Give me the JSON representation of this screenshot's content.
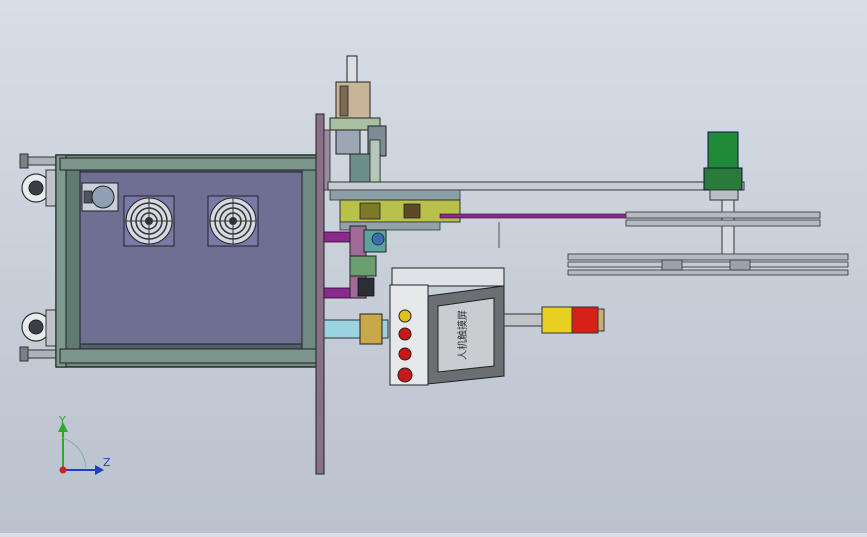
{
  "view": {
    "background_top": "#d8dee6",
    "background_bottom": "#b9c2cd"
  },
  "triad": {
    "y_label": "Y",
    "z_label": "Z",
    "y_color": "#2ea82e",
    "z_color": "#1f3fbf",
    "x_color": "#d0202a"
  },
  "control_panel": {
    "label": "人机触摸屏"
  },
  "signal_tower": {
    "colors": [
      "#e8d020",
      "#d82018",
      "#c8b070"
    ]
  },
  "motor": {
    "color": "#1e8a3a"
  },
  "buttons": {
    "colors": [
      "#e0c020",
      "#c81818",
      "#c81818",
      "#c81818"
    ]
  }
}
